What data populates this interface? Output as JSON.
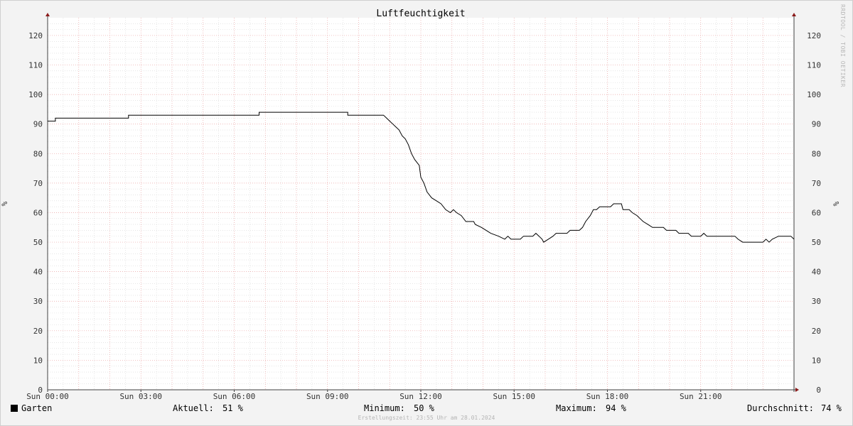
{
  "chart_data": {
    "type": "line",
    "title": "Luftfeuchtigkeit",
    "ylabel": "%",
    "xlabel": "",
    "ylim": [
      0,
      126
    ],
    "xlim_hours": [
      0,
      24
    ],
    "grid": true,
    "y_ticks": [
      0,
      10,
      20,
      30,
      40,
      50,
      60,
      70,
      80,
      90,
      100,
      110,
      120
    ],
    "x_ticks": [
      {
        "hour": 0,
        "label": "Sun 00:00"
      },
      {
        "hour": 3,
        "label": "Sun 03:00"
      },
      {
        "hour": 6,
        "label": "Sun 06:00"
      },
      {
        "hour": 9,
        "label": "Sun 09:00"
      },
      {
        "hour": 12,
        "label": "Sun 12:00"
      },
      {
        "hour": 15,
        "label": "Sun 15:00"
      },
      {
        "hour": 18,
        "label": "Sun 18:00"
      },
      {
        "hour": 21,
        "label": "Sun 21:00"
      }
    ],
    "series": [
      {
        "name": "Garten",
        "color": "#000000",
        "points": [
          [
            0.0,
            91
          ],
          [
            0.25,
            91
          ],
          [
            0.25,
            92
          ],
          [
            2.6,
            92
          ],
          [
            2.6,
            93
          ],
          [
            6.8,
            93
          ],
          [
            6.8,
            94
          ],
          [
            9.65,
            94
          ],
          [
            9.65,
            93
          ],
          [
            10.8,
            93
          ],
          [
            10.9,
            92
          ],
          [
            11.0,
            91
          ],
          [
            11.1,
            90
          ],
          [
            11.2,
            89
          ],
          [
            11.3,
            88
          ],
          [
            11.4,
            86
          ],
          [
            11.5,
            85
          ],
          [
            11.6,
            83
          ],
          [
            11.7,
            80
          ],
          [
            11.8,
            78
          ],
          [
            11.95,
            76
          ],
          [
            12.0,
            72
          ],
          [
            12.1,
            70
          ],
          [
            12.2,
            67
          ],
          [
            12.35,
            65
          ],
          [
            12.5,
            64
          ],
          [
            12.65,
            63
          ],
          [
            12.8,
            61
          ],
          [
            12.95,
            60
          ],
          [
            13.05,
            61
          ],
          [
            13.15,
            60
          ],
          [
            13.3,
            59
          ],
          [
            13.45,
            57
          ],
          [
            13.7,
            57
          ],
          [
            13.75,
            56
          ],
          [
            13.95,
            55
          ],
          [
            14.1,
            54
          ],
          [
            14.25,
            53
          ],
          [
            14.5,
            52
          ],
          [
            14.7,
            51
          ],
          [
            14.8,
            52
          ],
          [
            14.9,
            51
          ],
          [
            15.2,
            51
          ],
          [
            15.3,
            52
          ],
          [
            15.6,
            52
          ],
          [
            15.7,
            53
          ],
          [
            15.8,
            52
          ],
          [
            15.9,
            51
          ],
          [
            15.95,
            50
          ],
          [
            16.1,
            51
          ],
          [
            16.25,
            52
          ],
          [
            16.35,
            53
          ],
          [
            16.7,
            53
          ],
          [
            16.8,
            54
          ],
          [
            17.1,
            54
          ],
          [
            17.2,
            55
          ],
          [
            17.3,
            57
          ],
          [
            17.45,
            59
          ],
          [
            17.55,
            61
          ],
          [
            17.65,
            61
          ],
          [
            17.75,
            62
          ],
          [
            18.1,
            62
          ],
          [
            18.2,
            63
          ],
          [
            18.45,
            63
          ],
          [
            18.5,
            61
          ],
          [
            18.7,
            61
          ],
          [
            18.8,
            60
          ],
          [
            18.95,
            59
          ],
          [
            19.05,
            58
          ],
          [
            19.15,
            57
          ],
          [
            19.3,
            56
          ],
          [
            19.45,
            55
          ],
          [
            19.8,
            55
          ],
          [
            19.9,
            54
          ],
          [
            20.2,
            54
          ],
          [
            20.3,
            53
          ],
          [
            20.6,
            53
          ],
          [
            20.7,
            52
          ],
          [
            21.0,
            52
          ],
          [
            21.1,
            53
          ],
          [
            21.2,
            52
          ],
          [
            22.1,
            52
          ],
          [
            22.2,
            51
          ],
          [
            22.35,
            50
          ],
          [
            23.0,
            50
          ],
          [
            23.1,
            51
          ],
          [
            23.2,
            50
          ],
          [
            23.3,
            51
          ],
          [
            23.5,
            52
          ],
          [
            23.9,
            52
          ],
          [
            24.0,
            51
          ]
        ]
      }
    ]
  },
  "legend": {
    "series_name": "Garten",
    "current_label": "Aktuell:",
    "current_value": "51 %",
    "min_label": "Minimum:",
    "min_value": "50 %",
    "max_label": "Maximum:",
    "max_value": "94 %",
    "avg_label": "Durchschnitt:",
    "avg_value": "74 %"
  },
  "footer": "Erstellungszeit: 23:55 Uhr am 28.01.2024",
  "watermark": "RRDTOOL / TOBI OETIKER",
  "colors": {
    "background": "#f3f3f3",
    "canvas": "#ffffff",
    "major_grid": "#e9a0a0",
    "minor_grid": "#d6d6d6",
    "axis": "#404040",
    "arrow": "#8b1a1a"
  }
}
